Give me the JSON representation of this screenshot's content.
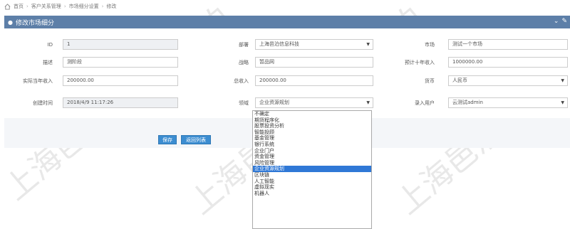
{
  "breadcrumb": [
    "首页",
    "客户关系管理",
    "市场细分设置",
    "修改"
  ],
  "panel": {
    "title": "修改市场细分",
    "header_icons": [
      "chevron-down-icon",
      "wrench-icon"
    ]
  },
  "form": {
    "id_label": "ID",
    "id_value": "1",
    "dept_label": "部署",
    "dept_value": "上海邑泊信息科技",
    "market_label": "市场",
    "market_value": "测试一个市场",
    "desc_label": "描述",
    "desc_value": "测阶段",
    "strategy_label": "战略",
    "strategy_value": "暂品网",
    "est10y_label": "预计十年收入",
    "est10y_value": "1000000.00",
    "actual_label": "实际当年收入",
    "actual_value": "200000.00",
    "total_label": "总收入",
    "total_value": "200000.00",
    "currency_label": "货币",
    "currency_value": "人民币",
    "created_label": "创建时间",
    "created_value": "2018/4/9 11:17:26",
    "domain_label": "领域",
    "domain_value": "企业资源规划",
    "entry_label": "录入用户",
    "entry_value": "云测试admin"
  },
  "buttons": {
    "save": "保存",
    "back": "返回列表"
  },
  "dropdown": {
    "options": [
      "不确定",
      "期货程序化",
      "股票投资分析",
      "智能投顾",
      "基金管理",
      "银行系统",
      "企业门户",
      "资金管理",
      "风险管理",
      "企业资源规划",
      "区块链",
      "人工智能",
      "虚拟现实",
      "机器人"
    ],
    "selected": "企业资源规划"
  },
  "colors": {
    "header": "#5d7fa8",
    "button": "#3c8dd1",
    "selected": "#2f78d6"
  },
  "watermark": "上海邑泊"
}
